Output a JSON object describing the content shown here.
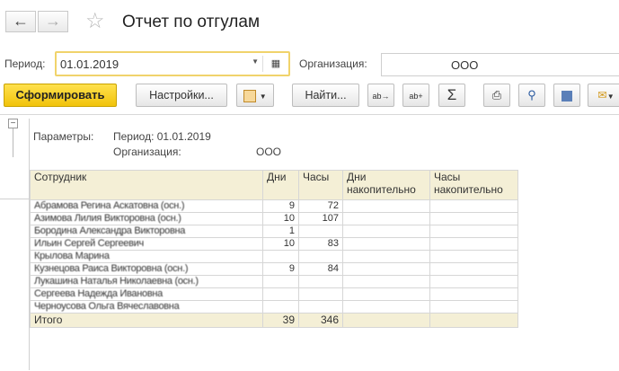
{
  "window": {
    "title": "Отчет по отгулам"
  },
  "nav": {
    "back_icon": "arrow-left",
    "forward_icon": "arrow-right"
  },
  "form": {
    "period_label": "Период:",
    "period_value": "01.01.2019",
    "org_label": "Организация:",
    "org_value": "ООО"
  },
  "toolbar": {
    "generate": "Сформировать",
    "settings": "Настройки...",
    "find": "Найти...",
    "sum_symbol": "Σ"
  },
  "params": {
    "label": "Параметры:",
    "period": "Период: 01.01.2019",
    "org_label": "Организация:",
    "org_value": "ООО"
  },
  "table": {
    "headers": [
      "Сотрудник",
      "Дни",
      "Часы",
      "Дни накопительно",
      "Часы накопительно"
    ],
    "rows": [
      {
        "name": "Абрамова Регина Аскатовна (осн.)",
        "days": "9",
        "hours": "72"
      },
      {
        "name": "Азимова Лилия Викторовна (осн.)",
        "days": "10",
        "hours": "107"
      },
      {
        "name": "Бородина Александра Викторовна",
        "days": "1",
        "hours": ""
      },
      {
        "name": "Ильин Сергей Сергеевич",
        "days": "10",
        "hours": "83"
      },
      {
        "name": "Крылова Марина",
        "days": "",
        "hours": ""
      },
      {
        "name": "Кузнецова Раиса Викторовна (осн.)",
        "days": "9",
        "hours": "84"
      },
      {
        "name": "Лукашина Наталья Николаевна (осн.)",
        "days": "",
        "hours": ""
      },
      {
        "name": "Сергеева Надежда Ивановна",
        "days": "",
        "hours": ""
      },
      {
        "name": "Черноусова Ольга Вячеславовна",
        "days": "",
        "hours": ""
      }
    ],
    "total": {
      "label": "Итого",
      "days": "39",
      "hours": "346"
    }
  }
}
